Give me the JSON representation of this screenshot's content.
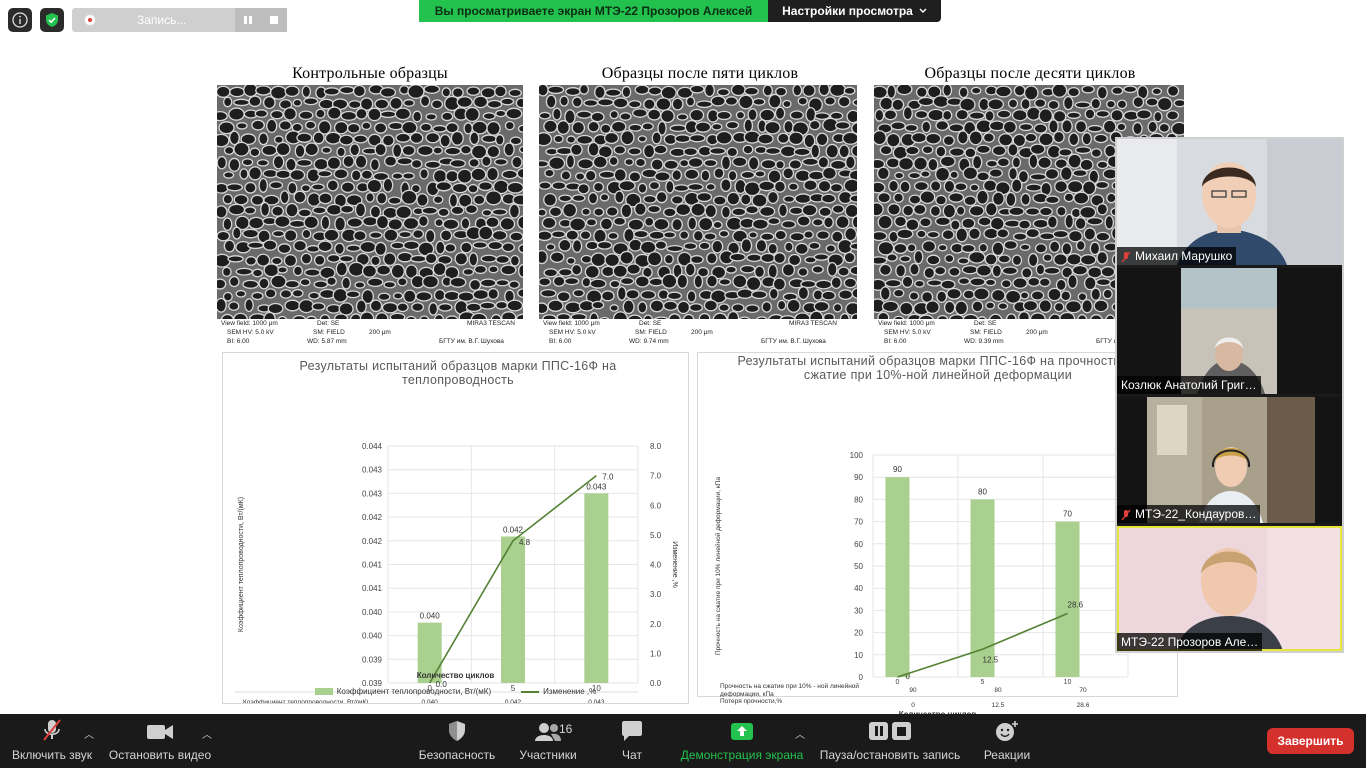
{
  "top_left": {
    "info_icon": "info-icon",
    "security_icon": "shield-check-icon",
    "recording_label": "Запись..."
  },
  "share_banner": {
    "viewing_text": "Вы просматриваете экран МТЭ-22 Прозоров Алексей",
    "view_options_label": "Настройки просмотра"
  },
  "slide": {
    "column_titles": [
      "Контрольные образцы",
      "Образцы после пяти циклов",
      "Образцы после десяти циклов"
    ],
    "sem_panels": [
      {
        "view_field": "View field: 1000 μm",
        "det": "Det: SE",
        "hv": "SEM HV: 5.0 kV",
        "sm": "SM: FIELD",
        "scale": "200 μm",
        "bi": "BI: 6.00",
        "wd": "WD: 5.87 mm",
        "brand": "MIRA3 TESCAN",
        "org": "БГТУ им. В.Г. Шухова"
      },
      {
        "view_field": "View field: 1000 μm",
        "det": "Det: SE",
        "hv": "SEM HV: 5.0 kV",
        "sm": "SM: FIELD",
        "scale": "200 μm",
        "bi": "BI: 6.00",
        "wd": "WD: 9.74 mm",
        "brand": "MIRA3 TESCAN",
        "org": "БГТУ им. В.Г. Шухова"
      },
      {
        "view_field": "View field: 1000 μm",
        "det": "Det: SE",
        "hv": "SEM HV: 5.0 kV",
        "sm": "SM: FIELD",
        "scale": "200 μm",
        "bi": "BI: 6.00",
        "wd": "WD: 9.39 mm",
        "brand": "",
        "org": "БГТУ им. В.Г. Шухова"
      }
    ]
  },
  "chart_data": [
    {
      "type": "bar",
      "title": "Результаты испытаний образцов марки ППС-16Ф на теплопроводность",
      "xlabel": "Количество циклов",
      "ylabel": "Коэффициент теплопроводности, Вт/(мК)",
      "y2label": "Изменение ,%",
      "categories": [
        "0",
        "5",
        "10"
      ],
      "ytick_labels": [
        "0.044",
        "0.043",
        "0.043",
        "0.042",
        "0.042",
        "0.041",
        "0.041",
        "0.040",
        "0.040",
        "0.039",
        "0.039"
      ],
      "y2tick_labels": [
        "8.0",
        "7.0",
        "6.0",
        "5.0",
        "4.0",
        "3.0",
        "2.0",
        "1.0",
        "0.0"
      ],
      "ylim": [
        0.0386,
        0.0441
      ],
      "y2lim": [
        0,
        8
      ],
      "series": [
        {
          "name": "Коэффициент теплопроводности, Вт/(мК)",
          "kind": "bar",
          "axis": "left",
          "values": [
            0.04,
            0.042,
            0.043
          ],
          "value_labels": [
            "0.040",
            "0.042",
            "0.043"
          ],
          "table_label": "Коэффициент теплопроводности, Вт/(мК)",
          "color": "#a9d08e"
        },
        {
          "name": "Изменение ,%",
          "kind": "line",
          "axis": "right",
          "values": [
            0.0,
            4.8,
            7.0
          ],
          "value_labels": [
            "0.0",
            "4.8",
            "7.0"
          ],
          "table_label": "Изменение ,%",
          "color": "#548235"
        }
      ],
      "table_rows": [
        {
          "label": "Коэффициент теплопроводности, Вт/(мК)",
          "values": [
            "0.040",
            "0.042",
            "0.043"
          ]
        },
        {
          "label": "Изменение ,%",
          "values": [
            "0.0",
            "4.8",
            "7.0"
          ]
        }
      ],
      "legend": [
        "Коэффициент теплопроводности, Вт/(мК)",
        "Изменение ,%"
      ],
      "legend_position": "bottom"
    },
    {
      "type": "bar",
      "title": "Результаты испытаний образцов марки ППС-16Ф на прочность на сжатие при 10%-ной линейной деформации",
      "xlabel": "Количество циклов",
      "ylabel": "Прочность на сжатие при 10% линейной деформации, кПа",
      "categories": [
        "0",
        "5",
        "10"
      ],
      "ytick_labels": [
        "100",
        "90",
        "80",
        "70",
        "60",
        "50",
        "40",
        "30",
        "20",
        "10",
        "0"
      ],
      "ylim": [
        0,
        100
      ],
      "series": [
        {
          "name": "Прочность на сжатие при 10% - ной линейной деформации, кПа",
          "kind": "bar",
          "values": [
            90,
            80,
            70
          ],
          "value_labels": [
            "90",
            "80",
            "70"
          ],
          "table_label": "Прочность на сжатие при 10% - ной линейной деформации, кПа",
          "color": "#a9d08e"
        },
        {
          "name": "Потеря прочности,%",
          "kind": "line",
          "values": [
            0,
            12.5,
            28.6
          ],
          "value_labels": [
            "0",
            "12.5",
            "28.6"
          ],
          "table_label": "Потеря прочности,%",
          "color": "#548235"
        }
      ],
      "table_rows": [
        {
          "label": "Прочность на сжатие при 10% - ной линейной деформации, кПа",
          "values": [
            "90",
            "80",
            "70"
          ]
        },
        {
          "label": "Потеря прочности,%",
          "values": [
            "0",
            "12.5",
            "28.6"
          ]
        }
      ],
      "legend": [
        "Прочность на сжатие при 10% - ной линейной деформации, кПа",
        "Потеря прочности,%"
      ],
      "legend_position": "bottom"
    }
  ],
  "participants": [
    {
      "name": "Михаил Марушко",
      "muted": true
    },
    {
      "name": "Козлюк Анатолий Григ…",
      "muted": false
    },
    {
      "name": "МТЭ-22_Кондауров…",
      "muted": true
    },
    {
      "name": "МТЭ-22 Прозоров Але…",
      "muted": false
    }
  ],
  "toolbar": {
    "unmute_label": "Включить звук",
    "stop_video_label": "Остановить видео",
    "security_label": "Безопасность",
    "participants_label": "Участники",
    "participants_count": "16",
    "chat_label": "Чат",
    "share_label": "Демонстрация экрана",
    "record_label": "Пауза/остановить запись",
    "reactions_label": "Реакции",
    "end_label": "Завершить",
    "share_color": "#23c14d",
    "end_color": "#d4312d"
  }
}
